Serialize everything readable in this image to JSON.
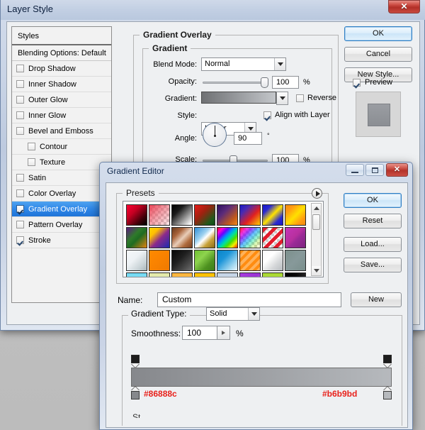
{
  "desktop": {
    "background": "#c0c0c0"
  },
  "layer_style": {
    "title": "Layer Style",
    "close_label": "✕",
    "styles_panel": {
      "header": "Styles",
      "items": [
        {
          "label": "Blending Options: Default",
          "checkbox": false,
          "indent": false,
          "selected": false,
          "bold": true
        },
        {
          "label": "Drop Shadow",
          "checkbox": true,
          "checked": false,
          "indent": false,
          "selected": false
        },
        {
          "label": "Inner Shadow",
          "checkbox": true,
          "checked": false,
          "indent": false,
          "selected": false
        },
        {
          "label": "Outer Glow",
          "checkbox": true,
          "checked": false,
          "indent": false,
          "selected": false
        },
        {
          "label": "Inner Glow",
          "checkbox": true,
          "checked": false,
          "indent": false,
          "selected": false
        },
        {
          "label": "Bevel and Emboss",
          "checkbox": true,
          "checked": false,
          "indent": false,
          "selected": false
        },
        {
          "label": "Contour",
          "checkbox": true,
          "checked": false,
          "indent": true,
          "selected": false
        },
        {
          "label": "Texture",
          "checkbox": true,
          "checked": false,
          "indent": true,
          "selected": false
        },
        {
          "label": "Satin",
          "checkbox": true,
          "checked": false,
          "indent": false,
          "selected": false
        },
        {
          "label": "Color Overlay",
          "checkbox": true,
          "checked": false,
          "indent": false,
          "selected": false
        },
        {
          "label": "Gradient Overlay",
          "checkbox": true,
          "checked": true,
          "indent": false,
          "selected": true
        },
        {
          "label": "Pattern Overlay",
          "checkbox": true,
          "checked": false,
          "indent": false,
          "selected": false
        },
        {
          "label": "Stroke",
          "checkbox": true,
          "checked": true,
          "indent": false,
          "selected": false
        }
      ]
    },
    "settings": {
      "group_title": "Gradient Overlay",
      "subgroup_title": "Gradient",
      "blend_mode_label": "Blend Mode:",
      "blend_mode_value": "Normal",
      "opacity_label": "Opacity:",
      "opacity_value": "100",
      "opacity_unit": "%",
      "gradient_label": "Gradient:",
      "gradient_from": "#6f7174",
      "gradient_to": "#c3c6ca",
      "reverse_label": "Reverse",
      "reverse_checked": false,
      "style_label": "Style:",
      "style_value": "Linear",
      "align_label": "Align with Layer",
      "align_checked": true,
      "angle_label": "Angle:",
      "angle_value": "90",
      "angle_unit": "°",
      "scale_label": "Scale:",
      "scale_value": "100",
      "scale_unit": "%"
    },
    "buttons": {
      "ok": "OK",
      "cancel": "Cancel",
      "new_style": "New Style...",
      "preview_label": "Preview",
      "preview_checked": true
    }
  },
  "gradient_editor": {
    "title": "Gradient Editor",
    "minimize_label": "minimize-icon",
    "maximize_label": "maximize-icon",
    "close_label": "✕",
    "presets": {
      "label": "Presets",
      "menu_icon": "presets-menu-arrow-icon",
      "swatches": [
        {
          "name": "foreground-to-background-red",
          "css": "linear-gradient(135deg,#ff0033 0%,#c40022 35%,#3a0008 75%,#000000 100%)"
        },
        {
          "name": "foreground-to-transparent-red",
          "checker": true,
          "css": "linear-gradient(135deg,rgba(235,60,80,0.95) 0%,rgba(235,90,105,0.6) 45%,rgba(235,120,130,0.15) 100%)"
        },
        {
          "name": "black-white",
          "css": "linear-gradient(135deg,#000000 0%,#1a1a1a 30%,#ffffff 95%)"
        },
        {
          "name": "red-green",
          "css": "linear-gradient(135deg,#e81a17 0%,#9d2210 40%,#1d5a1b 80%,#0d4a14 100%)"
        },
        {
          "name": "violet-orange",
          "css": "linear-gradient(135deg,#2e1060 0%,#5b2b7a 35%,#c05a1c 75%,#f2891d 100%)"
        },
        {
          "name": "blue-red-yellow",
          "css": "linear-gradient(135deg,#1818c8 0%,#4a2bb0 25%,#e02020 60%,#ffd000 100%)"
        },
        {
          "name": "blue-yellow-blue",
          "css": "linear-gradient(135deg,#1818c8 0%,#2a2ad0 22%,#ffe400 50%,#2a2ad0 78%,#1818c8 100%)"
        },
        {
          "name": "orange-yellow-orange",
          "css": "linear-gradient(135deg,#f08a10 0%,#ff9a12 22%,#ffe000 52%,#ff9a12 80%,#f08a10 100%)"
        },
        {
          "name": "violet-green-orange",
          "css": "linear-gradient(135deg,#5b1b80 0%,#2f7a2a 38%,#1f6b22 55%,#e0820f 100%)"
        },
        {
          "name": "yellow-violet-blue",
          "css": "linear-gradient(135deg,#ffd400 0%,#ffc000 25%,#8b2a8b 55%,#1a2ab0 100%)"
        },
        {
          "name": "copper",
          "css": "linear-gradient(135deg,#6b3a1c 0%,#a8633a 28%,#e8cdb8 52%,#b06c3e 75%,#7a4222 100%)"
        },
        {
          "name": "chrome",
          "css": "linear-gradient(135deg,#2f8fd8 0%,#9fd2f0 38%,#ffffff 52%,#c8a23a 72%,#8a6b18 100%)"
        },
        {
          "name": "spectrum",
          "css": "linear-gradient(135deg,#ff0000 0%,#ff00d4 14%,#6a00ff 28%,#0090ff 42%,#00e0a0 56%,#48e000 70%,#f0f000 84%,#ff2000 100%)"
        },
        {
          "name": "transparent-rainbow",
          "checker": true,
          "css": "linear-gradient(135deg,rgba(255,0,0,0.9) 0%,rgba(255,0,200,0.8) 16%,rgba(110,0,255,0.7) 32%,rgba(0,150,255,0.6) 48%,rgba(0,220,160,0.45) 64%,rgba(150,230,0,0.3) 80%,rgba(255,240,0,0.1) 100%)"
        },
        {
          "name": "transparent-stripes",
          "checker": true,
          "css": "repeating-linear-gradient(135deg,#e21d2c 0px,#e21d2c 5px,rgba(255,255,255,0) 5px,rgba(255,255,255,0) 10px)"
        },
        {
          "name": "magenta-purple",
          "css": "linear-gradient(135deg,#c436b8 0%,#b8309f 45%,#9a2a96 60%,#7d2580 100%)"
        },
        {
          "name": "steel-white",
          "css": "linear-gradient(135deg,#f5f8fa 0%,#eef2f5 40%,#c6d0d4 78%,#a8b4b8 100%)"
        },
        {
          "name": "orange-solid",
          "css": "linear-gradient(135deg,#ff8a00 0%,#f98200 50%,#ef7a00 100%)"
        },
        {
          "name": "black-gray",
          "css": "linear-gradient(135deg,#070707 0%,#1e1e1e 40%,#4a4a4a 75%,#6e6e6e 100%)"
        },
        {
          "name": "green-leaf",
          "css": "linear-gradient(135deg,#6fbf32 0%,#8ed44e 35%,#4e9220 70%,#3c7c18 100%)"
        },
        {
          "name": "blue-sky",
          "css": "linear-gradient(135deg,#0a84c8 0%,#1b94d8 35%,#9fd6ef 75%,#eaf5fb 100%)"
        },
        {
          "name": "orange-stripes",
          "css": "repeating-linear-gradient(135deg,#ff8c10 0px,#ff8c10 4px,#ffb25a 4px,#ffb25a 8px)"
        },
        {
          "name": "silver-white",
          "css": "linear-gradient(135deg,#fafafa 0%,#ffffff 35%,#d4d6d8 70%,#b8bcc0 100%)"
        },
        {
          "name": "sage-gray",
          "css": "linear-gradient(135deg,#7c908c 0%,#87999a 50%,#7a8f8c 100%)"
        },
        {
          "name": "cyan-light",
          "css": "linear-gradient(180deg,#6fd8f2 0%,#9ee6f7 60%,#c8f0fa 100%)"
        },
        {
          "name": "pale-yellow-green",
          "css": "linear-gradient(180deg,#e2e8a8 0%,#eaefb8 60%,#f0f4c8 100%)"
        },
        {
          "name": "amber",
          "css": "linear-gradient(180deg,#ffb43a 0%,#ffc45a 60%,#ffd27a 100%)"
        },
        {
          "name": "gold",
          "css": "linear-gradient(180deg,#ffc000 0%,#ffcb18 60%,#ffd63a 100%)"
        },
        {
          "name": "pale-blue",
          "css": "linear-gradient(180deg,#c4d4e6 0%,#d4e0ee 60%,#e2ebf4 100%)"
        },
        {
          "name": "purple-violet",
          "css": "linear-gradient(135deg,#a83ce0 0%,#9a32d4 48%,#b868ea 70%,#c888f0 100%)"
        },
        {
          "name": "lime",
          "css": "linear-gradient(180deg,#a8d830 0%,#b4de4a 60%,#c0e464 100%)"
        },
        {
          "name": "black-fade",
          "css": "linear-gradient(90deg,#000000 0%,#0a0a0a 55%,#222222 100%)"
        }
      ],
      "scroll_up_icon": "scroll-up-arrow-icon",
      "scroll_down_icon": "scroll-down-arrow-icon"
    },
    "name_label": "Name:",
    "name_value": "Custom",
    "new_button": "New",
    "gradient_type_label": "Gradient Type:",
    "gradient_type_value": "Solid",
    "smoothness_label": "Smoothness:",
    "smoothness_value": "100",
    "smoothness_unit": "%",
    "gradient_bar": {
      "from_color": "#86888c",
      "to_color": "#b6b9bd",
      "left_stop_code": "#86888c",
      "right_stop_code": "#b6b9bd"
    },
    "buttons": {
      "ok": "OK",
      "reset": "Reset",
      "load": "Load...",
      "save": "Save..."
    },
    "clipped_label": "St"
  }
}
